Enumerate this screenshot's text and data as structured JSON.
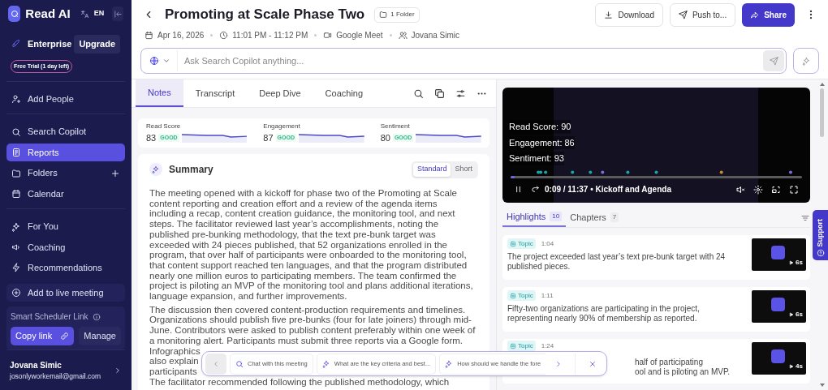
{
  "sidebar": {
    "logo": "Read AI",
    "language": "EN",
    "plan": {
      "name": "Enterprise",
      "upgrade": "Upgrade",
      "trial": "Free Trial (1 day left)"
    },
    "groups": [
      [
        {
          "label": "Add People",
          "selected": false
        }
      ],
      [
        {
          "label": "Search Copilot",
          "selected": false
        },
        {
          "label": "Reports",
          "selected": true
        },
        {
          "label": "Folders",
          "selected": false
        },
        {
          "label": "Calendar",
          "selected": false
        }
      ],
      [
        {
          "label": "For You",
          "selected": false
        },
        {
          "label": "Coaching",
          "selected": false
        },
        {
          "label": "Recommendations",
          "selected": false
        }
      ]
    ],
    "live_meeting": "Add to live meeting",
    "scheduler": {
      "title": "Smart Scheduler Link",
      "copy": "Copy link",
      "manage": "Manage"
    },
    "user": {
      "name": "Jovana Simic",
      "email": "josonlyworkemail@gmail.com"
    }
  },
  "header": {
    "title": "Promoting at Scale Phase Two",
    "folder": "1 Folder",
    "date": "Apr 16, 2026",
    "time": "11:01 PM - 11:12 PM",
    "app": "Google Meet",
    "owner": "Jovana Simic",
    "actions": [
      {
        "label": "Download",
        "kind": "secondary"
      },
      {
        "label": "Push to...",
        "kind": "secondary"
      },
      {
        "label": "Share",
        "kind": "primary"
      }
    ]
  },
  "search": {
    "placeholder": "Ask Search Copilot anything..."
  },
  "notes": {
    "tabs": [
      {
        "label": "Notes",
        "selected": true
      },
      {
        "label": "Transcript",
        "selected": false
      },
      {
        "label": "Deep Dive",
        "selected": false
      },
      {
        "label": "Coaching",
        "selected": false
      }
    ],
    "scores": [
      {
        "label": "Read Score",
        "value": "83",
        "rating": "GOOD"
      },
      {
        "label": "Engagement",
        "value": "87",
        "rating": "GOOD"
      },
      {
        "label": "Sentiment",
        "value": "80",
        "rating": "GOOD"
      }
    ],
    "summary": {
      "title": "Summary",
      "modes": [
        {
          "label": "Standard",
          "selected": true
        },
        {
          "label": "Short",
          "selected": false
        }
      ],
      "paragraphs": [
        "The meeting opened with a kickoff for phase two of the Promoting at Scale content reporting and creation effort and a review of the agenda items including a recap, content creation guidance, the monitoring tool, and next steps. The facilitator reviewed last year’s accomplishments, noting the published pre-bunking methodology, that the text pre-bunk target was exceeded with 24 pieces published, that 52 organizations enrolled in the program, that over half of participants were onboarded to the monitoring tool, that content support reached ten languages, and that the program distributed nearly one million euros to participating members. The team confirmed the project is piloting an MVP of the monitoring tool and plans additional iterations, language expansion, and further improvements.",
        "The discussion then covered content-production requirements and timelines. Organizations should publish five pre-bunks (four for late joiners) through mid-June. Contributors were asked to publish content preferably within one week of a monitoring alert. Participants must submit three reports via a Google form."
      ],
      "covered_lines": [
        "Infographics",
        "also explain",
        "participants"
      ],
      "last_line": "The facilitator recommended following the published methodology, which"
    }
  },
  "video": {
    "stats": [
      "Read Score: 90",
      "Engagement: 86",
      "Sentiment: 93"
    ],
    "time": "0:09 / 11:37 • Kickoff and Agenda",
    "level": 0.013
  },
  "highlights": {
    "tabs": [
      {
        "label": "Highlights",
        "count": "10",
        "selected": true
      },
      {
        "label": "Chapters",
        "count": "7",
        "selected": false
      }
    ],
    "cards": [
      {
        "tag": "Topic",
        "time": "1:04",
        "kind": "plain",
        "lines": [
          "The project exceeded last year’s text pre-bunk target with 24 published pieces."
        ],
        "duration": "6s"
      },
      {
        "tag": "Topic",
        "time": "1:11",
        "kind": "plain",
        "lines": [
          "Fifty-two organizations are participating in the project, representing nearly 90% of membership as reported."
        ],
        "duration": "6s"
      },
      {
        "tag": "Topic",
        "time": "1:24",
        "kind": "covered",
        "lines": [
          "half of participating",
          "ool and is piloting an MVP."
        ],
        "duration": "4s"
      }
    ]
  },
  "suggestions": [
    {
      "kind": "chat",
      "label": "Chat with this meeting"
    },
    {
      "kind": "prompt",
      "label": "What are the key criteria and best..."
    },
    {
      "kind": "prompt",
      "label": "How should we handle the fore"
    }
  ],
  "support": "Support"
}
